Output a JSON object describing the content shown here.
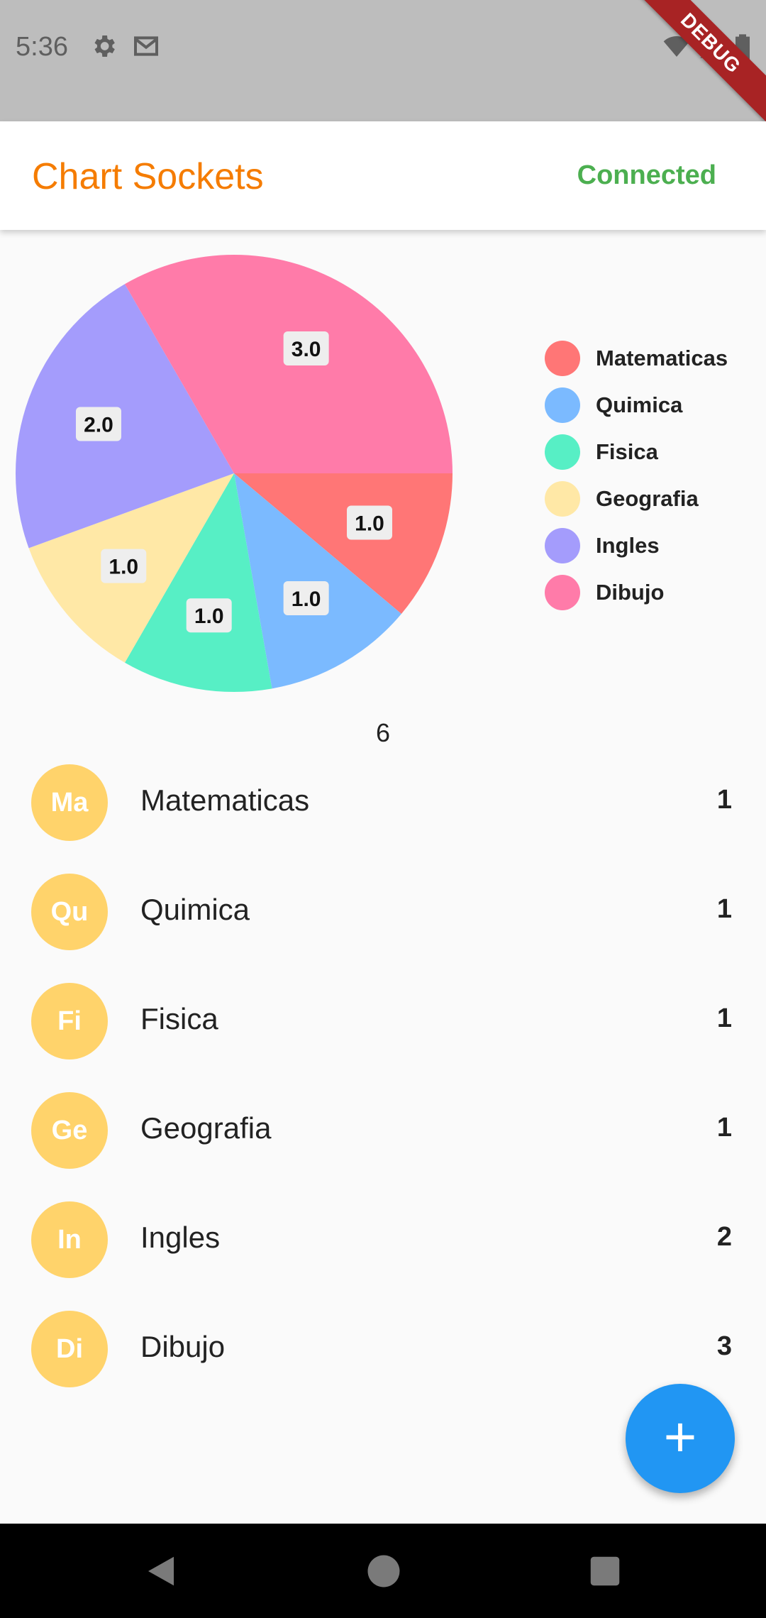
{
  "status_bar": {
    "time": "5:36",
    "banner": "DEBUG"
  },
  "app_bar": {
    "title": "Chart Sockets",
    "status": "Connected"
  },
  "colors": {
    "accent_title": "#f57c00",
    "status_connected": "#4caf50",
    "fab": "#2196f3",
    "avatar": "#ffd36b"
  },
  "chart_data": {
    "type": "pie",
    "categories": [
      "Matematicas",
      "Quimica",
      "Fisica",
      "Geografia",
      "Ingles",
      "Dibujo"
    ],
    "values": [
      1,
      1,
      1,
      1,
      2,
      3
    ],
    "labels": [
      "1.0",
      "1.0",
      "1.0",
      "1.0",
      "2.0",
      "3.0"
    ],
    "colors": [
      "#ff7676",
      "#7bbaff",
      "#57efc5",
      "#ffe8a6",
      "#a49cfc",
      "#ff7ba9"
    ],
    "legend_position": "right"
  },
  "total": "6",
  "list": {
    "items": [
      {
        "initials": "Ma",
        "name": "Matematicas",
        "value": "1"
      },
      {
        "initials": "Qu",
        "name": "Quimica",
        "value": "1"
      },
      {
        "initials": "Fi",
        "name": "Fisica",
        "value": "1"
      },
      {
        "initials": "Ge",
        "name": "Geografia",
        "value": "1"
      },
      {
        "initials": "In",
        "name": "Ingles",
        "value": "2"
      },
      {
        "initials": "Di",
        "name": "Dibujo",
        "value": "3"
      }
    ]
  },
  "fab": {
    "icon": "plus-icon",
    "label": "+"
  },
  "icons": [
    "settings-icon",
    "mail-icon",
    "wifi-icon",
    "signal-icon",
    "battery-icon",
    "back-icon",
    "home-icon",
    "recents-icon"
  ]
}
